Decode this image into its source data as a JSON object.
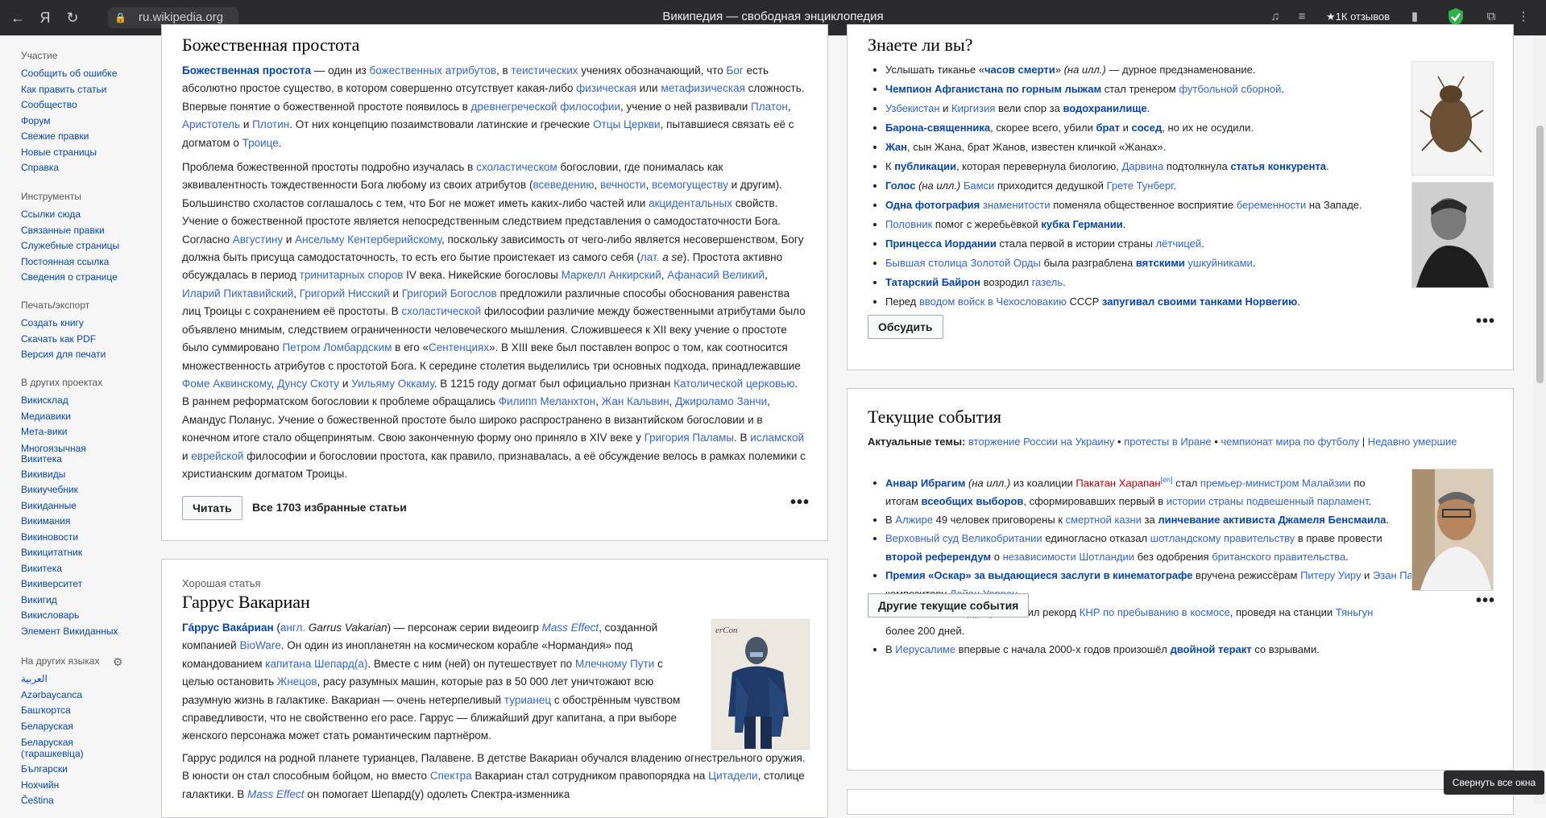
{
  "browser": {
    "url": "ru.wikipedia.org",
    "title": "Википедия — свободная энциклопедия",
    "reviews": "★1К отзывов"
  },
  "sidebar": {
    "participation": {
      "heading": "Участие",
      "items": [
        "Сообщить об ошибке",
        "Как править статьи",
        "Сообщество",
        "Форум",
        "Свежие правки",
        "Новые страницы",
        "Справка"
      ]
    },
    "tools": {
      "heading": "Инструменты",
      "items": [
        "Ссылки сюда",
        "Связанные правки",
        "Служебные страницы",
        "Постоянная ссылка",
        "Сведения о странице"
      ]
    },
    "print": {
      "heading": "Печать/экспорт",
      "items": [
        "Создать книгу",
        "Скачать как PDF",
        "Версия для печати"
      ]
    },
    "projects": {
      "heading": "В других проектах",
      "items": [
        "Викисклад",
        "Медиавики",
        "Мета-вики",
        "Многоязычная",
        "Викитека",
        "Викивиды",
        "Викиучебник",
        "Викиданные",
        "Викимания",
        "Викиновости",
        "Викицитатник",
        "Викитека",
        "Викиверситет",
        "Викигид",
        "Викисловарь",
        "Элемент Викиданных"
      ]
    },
    "languages": {
      "heading": "На других языках",
      "items": [
        "العربية",
        "Azərbaycanca",
        "Башҡортса",
        "Беларуская",
        "Беларуская",
        "(тарашкевіца)",
        "Български",
        "Нохчийн",
        "Čeština"
      ]
    }
  },
  "featured": {
    "title": "Божественная простота",
    "read_button": "Читать",
    "all_link": "Все 1703 избранные статьи"
  },
  "good": {
    "label": "Хорошая статья",
    "title": "Гаррус Вакариан"
  },
  "dyk": {
    "title": "Знаете ли вы?",
    "discuss_button": "Обсудить"
  },
  "news": {
    "title": "Текущие события",
    "more_button": "Другие текущие события"
  },
  "tooltip": "Свернуть все окна"
}
